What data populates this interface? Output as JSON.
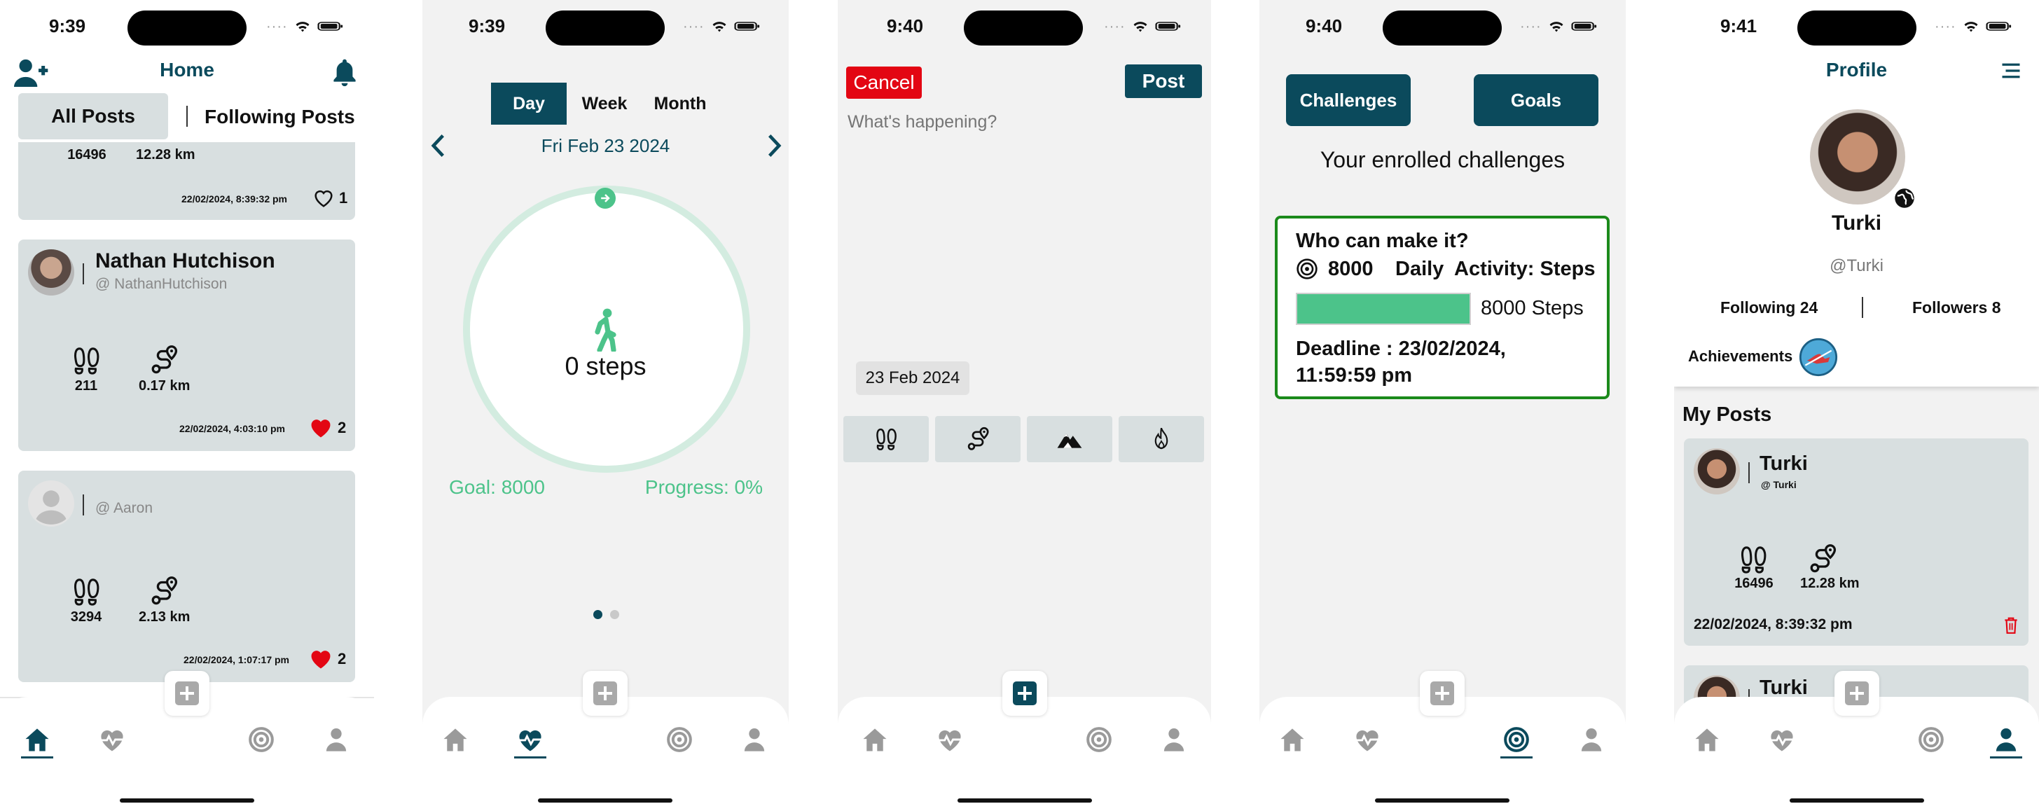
{
  "screens": {
    "home": {
      "time": "9:39",
      "title": "Home",
      "tabs": [
        "All Posts",
        "Following Posts"
      ],
      "partial_post": {
        "steps": "16496",
        "distance": "12.28 km",
        "timestamp": "22/02/2024, 8:39:32 pm",
        "likes": "1"
      },
      "posts": [
        {
          "name": "Nathan Hutchison",
          "handle": "@ NathanHutchison",
          "steps": "211",
          "distance": "0.17 km",
          "timestamp": "22/02/2024, 4:03:10 pm",
          "likes": "2"
        },
        {
          "name": "",
          "handle": "@ Aaron",
          "steps": "3294",
          "distance": "2.13 km",
          "timestamp": "22/02/2024, 1:07:17 pm",
          "likes": "2"
        }
      ]
    },
    "activity": {
      "time": "9:39",
      "periods": [
        "Day",
        "Week",
        "Month"
      ],
      "date": "Fri Feb 23 2024",
      "steps": "0 steps",
      "goal": "Goal: 8000",
      "progress": "Progress: 0%",
      "progress_value": 0
    },
    "compose": {
      "time": "9:40",
      "cancel": "Cancel",
      "post": "Post",
      "placeholder": "What's happening?",
      "date_chip": "23 Feb 2024",
      "metric_icons": [
        "footprints-icon",
        "route-icon",
        "mountain-icon",
        "flame-icon"
      ]
    },
    "challenges": {
      "time": "9:40",
      "tabs": [
        "Challenges",
        "Goals"
      ],
      "heading": "Your enrolled challenges",
      "card": {
        "title": "Who can make it?",
        "target": "8000",
        "frequency": "Daily",
        "activity": "Activity: Steps",
        "bar_label": "8000 Steps",
        "bar_fraction": 1.0,
        "deadline_line1": "Deadline : 23/02/2024,",
        "deadline_line2": "11:59:59 pm"
      }
    },
    "profile": {
      "time": "9:41",
      "title": "Profile",
      "name": "Turki",
      "handle": "@Turki",
      "following": "Following 24",
      "followers": "Followers 8",
      "achievements": "Achievements",
      "my_posts": "My Posts",
      "posts": [
        {
          "name": "Turki",
          "handle": "@ Turki",
          "steps": "16496",
          "distance": "12.28 km",
          "timestamp": "22/02/2024, 8:39:32 pm"
        },
        {
          "name": "Turki"
        }
      ]
    }
  },
  "colors": {
    "primary": "#0b4a5c",
    "accent_green": "#4cc38a",
    "like_red": "#e30613",
    "cancel_red": "#e30613",
    "card_bg": "#d8dfe0"
  }
}
